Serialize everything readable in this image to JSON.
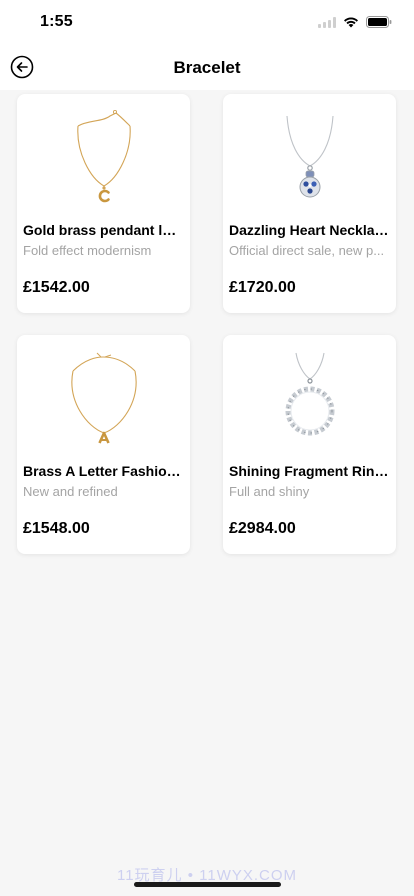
{
  "status_bar": {
    "time": "1:55"
  },
  "nav": {
    "title": "Bracelet",
    "back_icon": "arrow-left-circle-icon"
  },
  "products": [
    {
      "name": "Gold brass pendant lad...",
      "subtitle": "Fold effect modernism",
      "price": "£1542.00",
      "image": "gold-c-pendant-necklace"
    },
    {
      "name": "Dazzling Heart Necklac...",
      "subtitle": "Official direct sale, new p...",
      "price": "£1720.00",
      "image": "blue-crystal-pendant-necklace"
    },
    {
      "name": "Brass A Letter Fashion...",
      "subtitle": "New and refined",
      "price": "£1548.00",
      "image": "gold-a-pendant-necklace"
    },
    {
      "name": "Shining Fragment Ring...",
      "subtitle": "Full and shiny",
      "price": "£2984.00",
      "image": "silver-crystal-ring-pendant"
    }
  ],
  "watermark": "11玩育儿 • 11WYX.COM"
}
